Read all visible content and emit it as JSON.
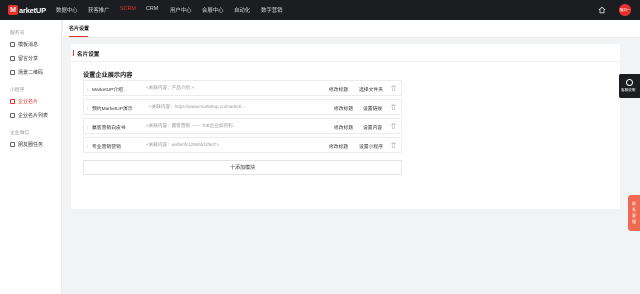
{
  "brand": {
    "mark": "M",
    "name": "arketUP"
  },
  "nav": [
    "数据中心",
    "获客推广",
    "SCRM",
    "CRM",
    "用户中心",
    "会展中心",
    "自动化",
    "数字营销"
  ],
  "nav_active_index": 2,
  "user": {
    "avatar_text": "随风一"
  },
  "sidebar": {
    "groups": [
      {
        "label": "服务号",
        "items": [
          "模板消息",
          "留言分享",
          "场景二维码"
        ]
      },
      {
        "label": "小程序",
        "items": [
          "企业名片",
          "企业名片列表"
        ]
      },
      {
        "label": "企业微信",
        "items": [
          "朋友圈任务"
        ]
      }
    ],
    "active_item": "企业名片"
  },
  "tab": {
    "label": "名片设置"
  },
  "panel": {
    "title": "名片设置",
    "section_title": "设置企业展示内容",
    "rows": [
      {
        "name": "MarketUP介绍",
        "content": "<关联内容：产品介绍 >",
        "action1": "修改标题",
        "action2": "选择文件夹"
      },
      {
        "name": "预约MarketUP演示",
        "content": "<关联内容：https://www.marketup.cn/market/...",
        "action1": "修改标题",
        "action2": "设置链接"
      },
      {
        "name": "赢客营销白皮书",
        "content": "<关联内容：赢客营销 —— ToB企业如何利...",
        "action1": "修改标题",
        "action2": "设置内容"
      },
      {
        "name": "专业营销营销",
        "content": "<关联内容：wxfle0fc1255f4d1f9d7>",
        "action1": "修改标题",
        "action2": "设置小程序"
      }
    ],
    "add_label": "十添加模块"
  },
  "float_dark": {
    "label": "客服说明"
  },
  "float_red": {
    "label": [
      "联",
      "系",
      "客",
      "服"
    ]
  },
  "colors": {
    "accent": "#e6312e",
    "topbar": "#1b1d21"
  }
}
